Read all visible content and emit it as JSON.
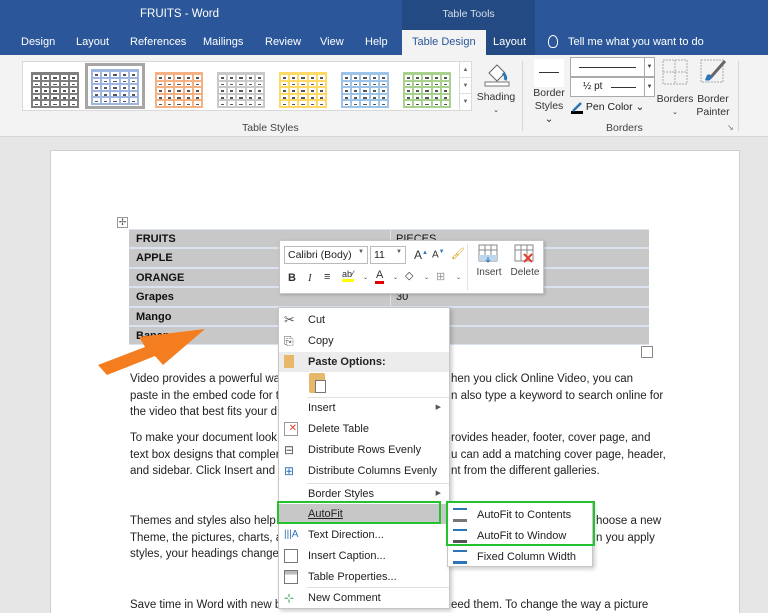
{
  "window": {
    "title": "FRUITS  -  Word",
    "context_label": "Table Tools"
  },
  "tabs": [
    {
      "label": "Design"
    },
    {
      "label": "Layout"
    },
    {
      "label": "References"
    },
    {
      "label": "Mailings"
    },
    {
      "label": "Review"
    },
    {
      "label": "View"
    },
    {
      "label": "Help"
    },
    {
      "label": "Table Design"
    },
    {
      "label": "Layout"
    }
  ],
  "tellme": {
    "placeholder": "Tell me what you want to do"
  },
  "ribbon": {
    "table_styles_label": "Table Styles",
    "styles": [
      {
        "name": "plain-grid",
        "color": "#7f7f7f"
      },
      {
        "name": "grid-blue-selected",
        "color": "#9fb7e0"
      },
      {
        "name": "grid-orange",
        "color": "#f4b183"
      },
      {
        "name": "grid-gray",
        "color": "#c9c9c9"
      },
      {
        "name": "grid-gold",
        "color": "#ffd966"
      },
      {
        "name": "grid-lightblue",
        "color": "#9dc3e6"
      },
      {
        "name": "grid-green",
        "color": "#a9d18e"
      }
    ],
    "shading_label": "Shading",
    "border_styles_label": "Border",
    "border_styles_label2": "Styles",
    "pen_weight": "½ pt",
    "pen_color_label": "Pen Color",
    "borders_label": "Borders",
    "border_painter_label": "Border",
    "border_painter_label2": "Painter",
    "borders_group_label": "Borders"
  },
  "table": {
    "rows": [
      {
        "c1": "FRUITS",
        "c2": "PIECES"
      },
      {
        "c1": "APPLE",
        "c2": ""
      },
      {
        "c1": "ORANGE",
        "c2": ""
      },
      {
        "c1": "Grapes",
        "c2": "30"
      },
      {
        "c1": "Mango",
        "c2": ""
      },
      {
        "c1": "Banana",
        "c2": ""
      }
    ]
  },
  "body": {
    "p1": [
      "Video provides a powerful wa",
      "paste in the embed code for t",
      "the video that best fits your d"
    ],
    "p1r": [
      "hen you click Online Video, you can",
      "n also type a keyword to search online for"
    ],
    "p2": [
      "To make your document look",
      "text box designs that compler",
      "and sidebar. Click Insert and t"
    ],
    "p2r": [
      "rovides header, footer, cover page, and",
      "u can add a matching cover page, header,",
      "nt from the different galleries."
    ],
    "p3": [
      "Themes and styles also help k",
      "Theme, the pictures, charts, a",
      "styles, your headings change"
    ],
    "p3r": [
      "hoose a new",
      "n you apply"
    ],
    "p4": "Save time in Word with new b",
    "p4r": "eed them. To change the way a picture"
  },
  "mini_toolbar": {
    "font": "Calibri (Body)",
    "size": "11",
    "insert": "Insert",
    "delete": "Delete",
    "highlight_color": "#ffff00",
    "font_color": "#e00000"
  },
  "context_menu": {
    "items": [
      {
        "label": "Cut"
      },
      {
        "label": "Copy"
      },
      {
        "label": "Paste Options:"
      },
      {
        "label": "Insert"
      },
      {
        "label": "Delete Table"
      },
      {
        "label": "Distribute Rows Evenly"
      },
      {
        "label": "Distribute Columns Evenly"
      },
      {
        "label": "Border Styles"
      },
      {
        "label": "AutoFit"
      },
      {
        "label": "Text Direction..."
      },
      {
        "label": "Insert Caption..."
      },
      {
        "label": "Table Properties..."
      },
      {
        "label": "New Comment"
      }
    ]
  },
  "autofit_submenu": {
    "items": [
      {
        "label": "AutoFit to Contents"
      },
      {
        "label": "AutoFit to Window"
      },
      {
        "label": "Fixed Column Width"
      }
    ]
  },
  "highlight_color": "#22c32e",
  "arrow_color": "#f47d20"
}
